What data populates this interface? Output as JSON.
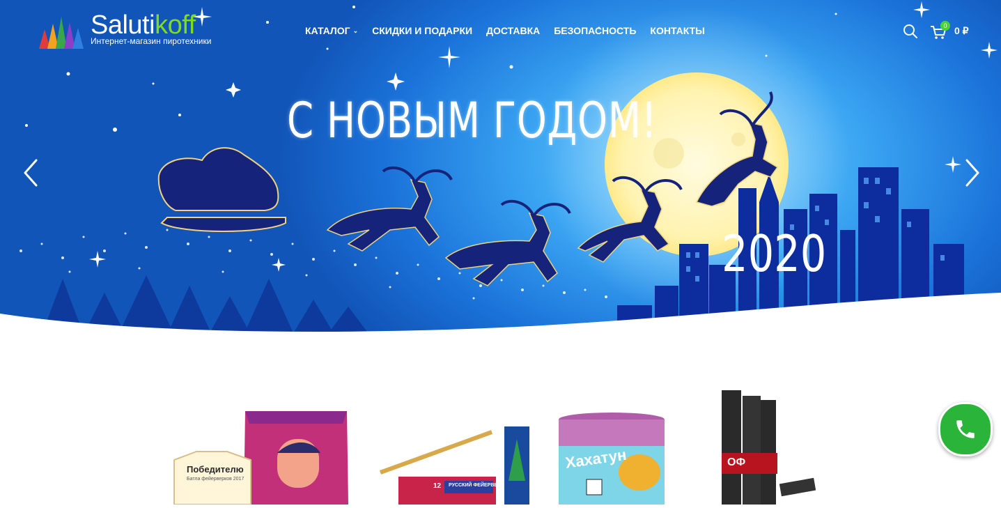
{
  "brand": {
    "name_main": "Saluti",
    "name_accent": "koff",
    "tagline": "Интернет-магазин пиротехники",
    "accent_color": "#7ddc1f"
  },
  "nav": {
    "items": [
      {
        "label": "КАТАЛОГ",
        "has_dropdown": true
      },
      {
        "label": "СКИДКИ И ПОДАРКИ"
      },
      {
        "label": "ДОСТАВКА"
      },
      {
        "label": "БЕЗОПАСНОСТЬ"
      },
      {
        "label": "КОНТАКТЫ"
      }
    ]
  },
  "header_actions": {
    "search_icon": "search-icon",
    "cart_icon": "cart-icon",
    "cart_count": "0",
    "cart_total": "0 ₽"
  },
  "hero": {
    "headline": "С НОВЫМ ГОДОМ!",
    "year": "2020",
    "prev_icon": "chevron-left-icon",
    "next_icon": "chevron-right-icon"
  },
  "products": {
    "items": [
      {
        "label": "Победителю",
        "sublabel": "Батла фейерверков 2017"
      },
      {
        "label": "РУССКИЙ ФЕЙЕРВЕРК",
        "count": "12"
      },
      {
        "label": "Хахатун"
      },
      {
        "label": "ОФ"
      }
    ]
  },
  "colors": {
    "sky_deep": "#1255b8",
    "sky_light": "#79d3ff",
    "reindeer": "#16237a",
    "moon": "#fff7c2",
    "phone_button": "#2bb43a"
  },
  "phone_button": {
    "icon": "phone-icon"
  }
}
